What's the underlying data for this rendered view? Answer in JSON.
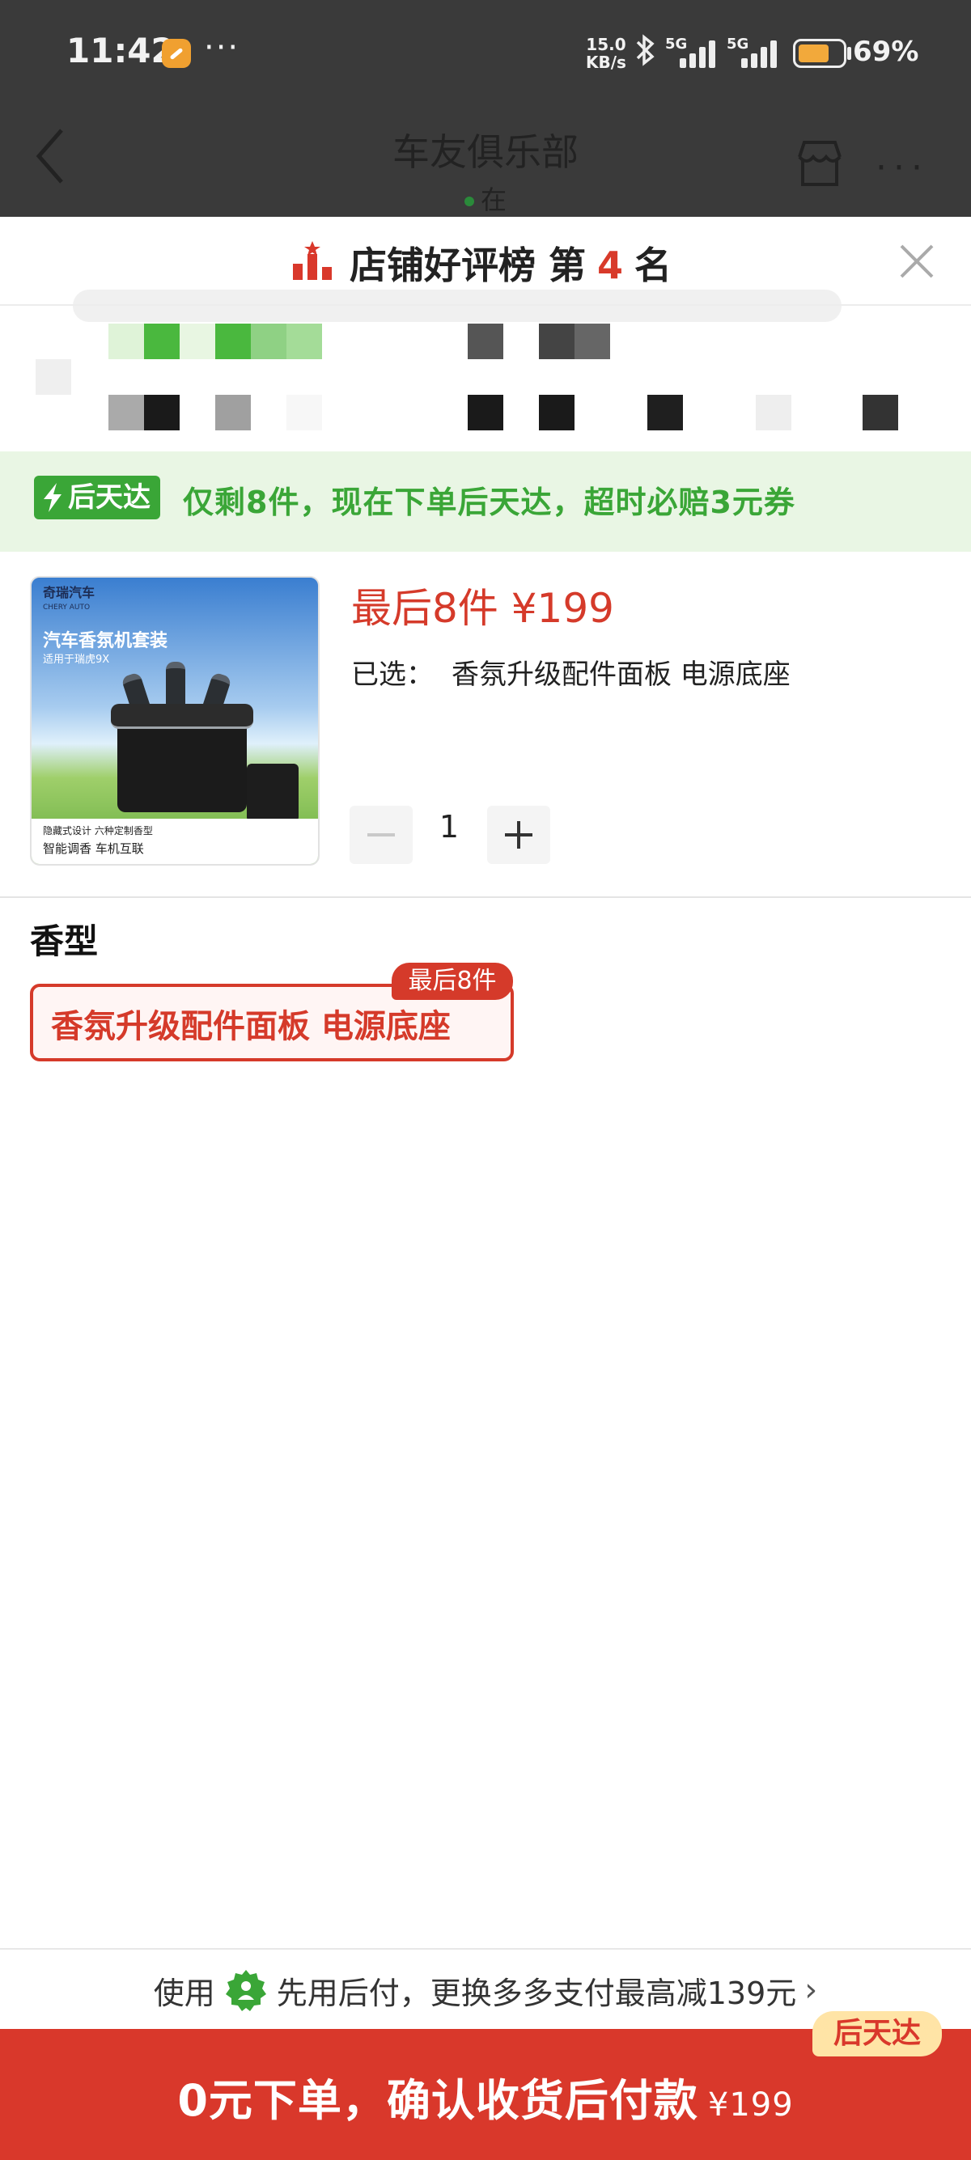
{
  "status_bar": {
    "time": "11:42",
    "overflow_dots": "···",
    "net_speed_value": "15.0",
    "net_speed_unit": "KB/s",
    "signal1_label": "5G",
    "signal2_label": "5G",
    "battery": "69%",
    "battery_level_percent": 69
  },
  "nav": {
    "title": "车友俱乐部",
    "subtitle": "在",
    "back_icon": "chevron-left-icon",
    "store_icon": "store-icon",
    "more": "···"
  },
  "rank_banner": {
    "text_before": "店铺好评榜 第",
    "rank": "4",
    "text_after": "名",
    "icon": "ranking-podium-icon"
  },
  "promo": {
    "badge": "后天达",
    "text": "仅剩8件，现在下单后天达，超时必赔3元券",
    "badge_color": "#3aa637",
    "background": "#e9f6e4"
  },
  "product": {
    "image": {
      "brand": "奇瑞汽车",
      "brand_en": "CHERY AUTO",
      "title": "汽车香氛机套装",
      "subtitle": "适用于瑞虎9X",
      "footer_line1": "隐藏式设计 六种定制香型",
      "footer_line2": "智能调香 车机互联"
    },
    "price": "最后8件 ¥199",
    "selected_label": "已选：",
    "selected_value": "香氛升级配件面板 电源底座",
    "quantity": "1"
  },
  "options": {
    "section_title": "香型",
    "items": [
      {
        "label": "香氛升级配件面板 电源底座",
        "tag": "最后8件",
        "selected": true
      }
    ]
  },
  "pay_bar": {
    "prefix": "使用",
    "text": "先用后付，更换多多支付最高减139元",
    "arrow": "›"
  },
  "order_button": {
    "text": "0元下单，确认收货后付款",
    "price": "¥199",
    "tag": "后天达",
    "color": "#d9382b"
  }
}
